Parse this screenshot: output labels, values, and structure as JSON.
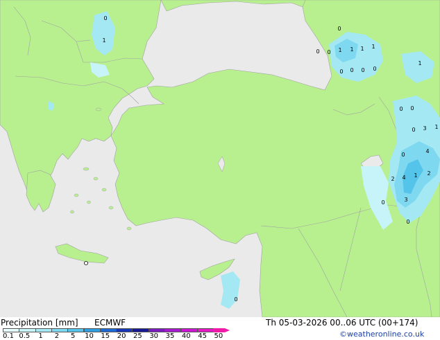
{
  "legend": {
    "title": "Precipitation [mm]",
    "model": "ECMWF",
    "datetime": "Th 05-03-2026 00..06 UTC (00+174)",
    "credit": "©weatheronline.co.uk",
    "ticks": [
      "0.1",
      "0.5",
      "1",
      "2",
      "5",
      "10",
      "15",
      "20",
      "25",
      "30",
      "35",
      "40",
      "45",
      "50"
    ],
    "colors": [
      "#e6ffff",
      "#c6f4f8",
      "#a4e8f4",
      "#7ed8f0",
      "#55c4ea",
      "#2f9ee2",
      "#1c6ad2",
      "#1838b8",
      "#1a1a96",
      "#7a1cc0",
      "#a81ad0",
      "#cc16d4",
      "#e818c8",
      "#f01ca6"
    ]
  },
  "map": {
    "land_color": "#b8f090",
    "sea_color": "#eaeaea",
    "border_color": "#a0a0a0",
    "precip_labels": [
      "0",
      "1",
      "0",
      "0",
      "1",
      "1",
      "1",
      "0",
      "0",
      "0",
      "0",
      "1",
      "0",
      "0",
      "0",
      "3",
      "1",
      "0",
      "1",
      "4",
      "2",
      "2",
      "4",
      "1",
      "0",
      "3",
      "0",
      "0",
      "0"
    ]
  }
}
